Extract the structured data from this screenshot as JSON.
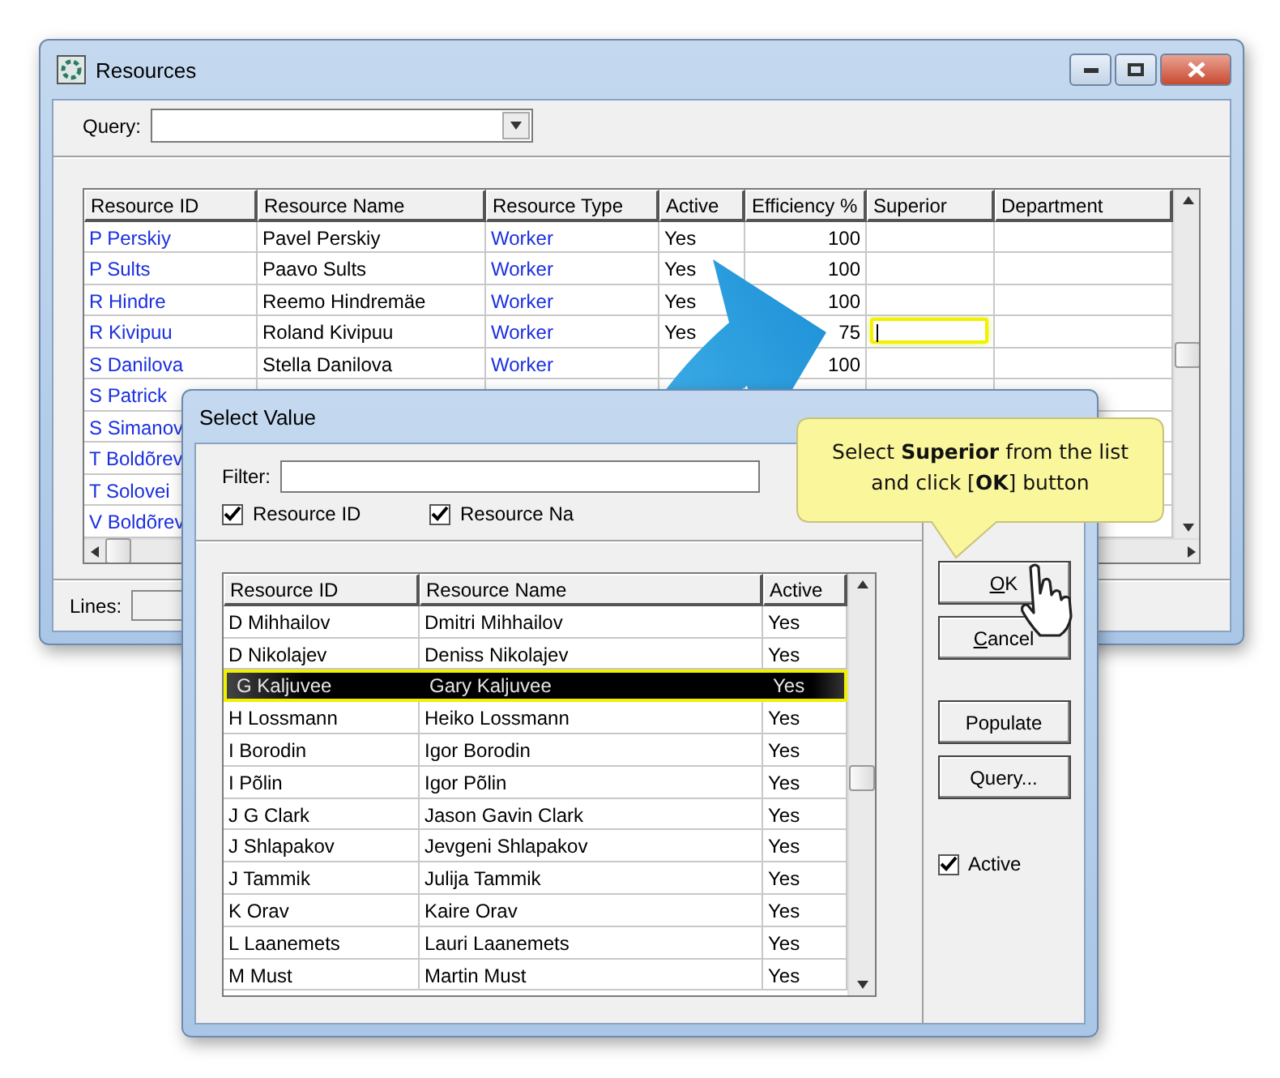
{
  "main_window": {
    "title": "Resources",
    "query": {
      "label": "Query:"
    },
    "grid": {
      "columns": [
        "Resource ID",
        "Resource Name",
        "Resource Type",
        "Active",
        "Efficiency %",
        "Superior",
        "Department"
      ],
      "rows": [
        {
          "resource_id": "P Perskiy",
          "resource_name": "Pavel Perskiy",
          "resource_type": "Worker",
          "active": "Yes",
          "efficiency": "100",
          "editing": false
        },
        {
          "resource_id": "P Sults",
          "resource_name": "Paavo Sults",
          "resource_type": "Worker",
          "active": "Yes",
          "efficiency": "100",
          "editing": false
        },
        {
          "resource_id": "R Hindre",
          "resource_name": "Reemo Hindremäe",
          "resource_type": "Worker",
          "active": "Yes",
          "efficiency": "100",
          "editing": false
        },
        {
          "resource_id": "R Kivipuu",
          "resource_name": "Roland Kivipuu",
          "resource_type": "Worker",
          "active": "Yes",
          "efficiency": "75",
          "editing": true
        },
        {
          "resource_id": "S Danilova",
          "resource_name": "Stella Danilova",
          "resource_type": "Worker",
          "efficiency": "100",
          "editing": false
        },
        {
          "resource_id": "S Patrick",
          "editing": false
        },
        {
          "resource_id": "S Simanov",
          "editing": false
        },
        {
          "resource_id": "T Boldõrev",
          "editing": false
        },
        {
          "resource_id": "T Solovei",
          "editing": false
        },
        {
          "resource_id": "V Boldõrev",
          "editing": false
        }
      ]
    },
    "status": {
      "label": "Lines:"
    }
  },
  "dialog": {
    "title": "Select Value",
    "filter": {
      "label": "Filter:"
    },
    "options": [
      {
        "label": "Resource ID",
        "checked": true
      },
      {
        "label": "Resource Na",
        "checked": true
      }
    ],
    "grid": {
      "columns": [
        "Resource ID",
        "Resource Name",
        "Active"
      ],
      "rows": [
        {
          "resource_id": "D Mihhailov",
          "resource_name": "Dmitri Mihhailov",
          "active": "Yes",
          "selected": false
        },
        {
          "resource_id": "D Nikolajev",
          "resource_name": "Deniss Nikolajev",
          "active": "Yes",
          "selected": false
        },
        {
          "resource_id": "G Kaljuvee",
          "resource_name": "Gary Kaljuvee",
          "active": "Yes",
          "selected": true
        },
        {
          "resource_id": "H Lossmann",
          "resource_name": "Heiko Lossmann",
          "active": "Yes",
          "selected": false
        },
        {
          "resource_id": "I Borodin",
          "resource_name": "Igor Borodin",
          "active": "Yes",
          "selected": false
        },
        {
          "resource_id": "I Põlin",
          "resource_name": "Igor Põlin",
          "active": "Yes",
          "selected": false
        },
        {
          "resource_id": "J G Clark",
          "resource_name": "Jason Gavin Clark",
          "active": "Yes",
          "selected": false
        },
        {
          "resource_id": "J Shlapakov",
          "resource_name": "Jevgeni Shlapakov",
          "active": "Yes",
          "selected": false
        },
        {
          "resource_id": "J Tammik",
          "resource_name": "Julija Tammik",
          "active": "Yes",
          "selected": false
        },
        {
          "resource_id": "K Orav",
          "resource_name": "Kaire Orav",
          "active": "Yes",
          "selected": false
        },
        {
          "resource_id": "L Laanemets",
          "resource_name": "Lauri Laanemets",
          "active": "Yes",
          "selected": false
        },
        {
          "resource_id": "M Must",
          "resource_name": "Martin Must",
          "active": "Yes",
          "selected": false
        }
      ]
    },
    "buttons": [
      {
        "label": "OK",
        "underline_first": true
      },
      {
        "label": "Cancel",
        "underline_first": true
      },
      {
        "label": "Populate",
        "underline_first": false
      },
      {
        "label": "Query...",
        "underline_first": false
      }
    ],
    "active_option": {
      "label": "Active",
      "checked": true
    }
  },
  "callout": {
    "text": "Select **Superior** from the list and click [**OK**] button"
  }
}
